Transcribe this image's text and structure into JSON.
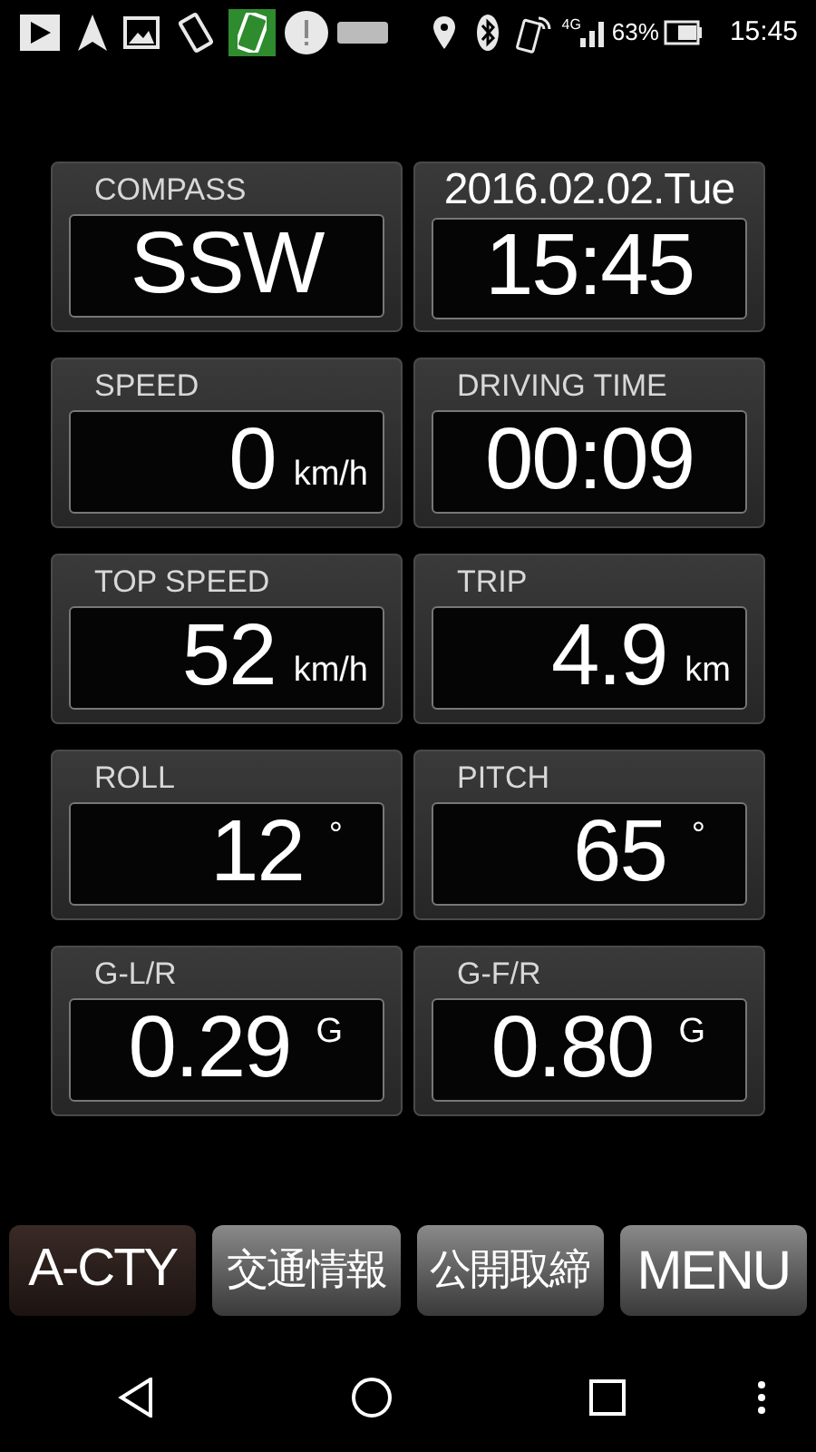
{
  "status_bar": {
    "network": "4G",
    "battery": "63%",
    "time": "15:45"
  },
  "cards": [
    {
      "kind": "label",
      "header": "COMPASS",
      "value": "SSW"
    },
    {
      "kind": "date",
      "header": "2016.02.02.Tue",
      "value": "15:45"
    },
    {
      "kind": "label",
      "header": "SPEED",
      "value": "0",
      "unit": "km/h"
    },
    {
      "kind": "label",
      "header": "DRIVING TIME",
      "value": "00:09"
    },
    {
      "kind": "label",
      "header": "TOP SPEED",
      "value": "52",
      "unit": "km/h"
    },
    {
      "kind": "label",
      "header": "TRIP",
      "value": "4.9",
      "unit": "km"
    },
    {
      "kind": "label",
      "header": "ROLL",
      "value": "12",
      "unit": "°"
    },
    {
      "kind": "label",
      "header": "PITCH",
      "value": "65",
      "unit": "°"
    },
    {
      "kind": "label",
      "header": "G-L/R",
      "value": "0.29",
      "unit": "G"
    },
    {
      "kind": "label",
      "header": "G-F/R",
      "value": "0.80",
      "unit": "G"
    }
  ],
  "buttons": [
    {
      "label": "A-CTY",
      "selected": true
    },
    {
      "label": "交通情報",
      "selected": false
    },
    {
      "label": "公開取締",
      "selected": false
    },
    {
      "label": "MENU",
      "selected": false
    }
  ]
}
